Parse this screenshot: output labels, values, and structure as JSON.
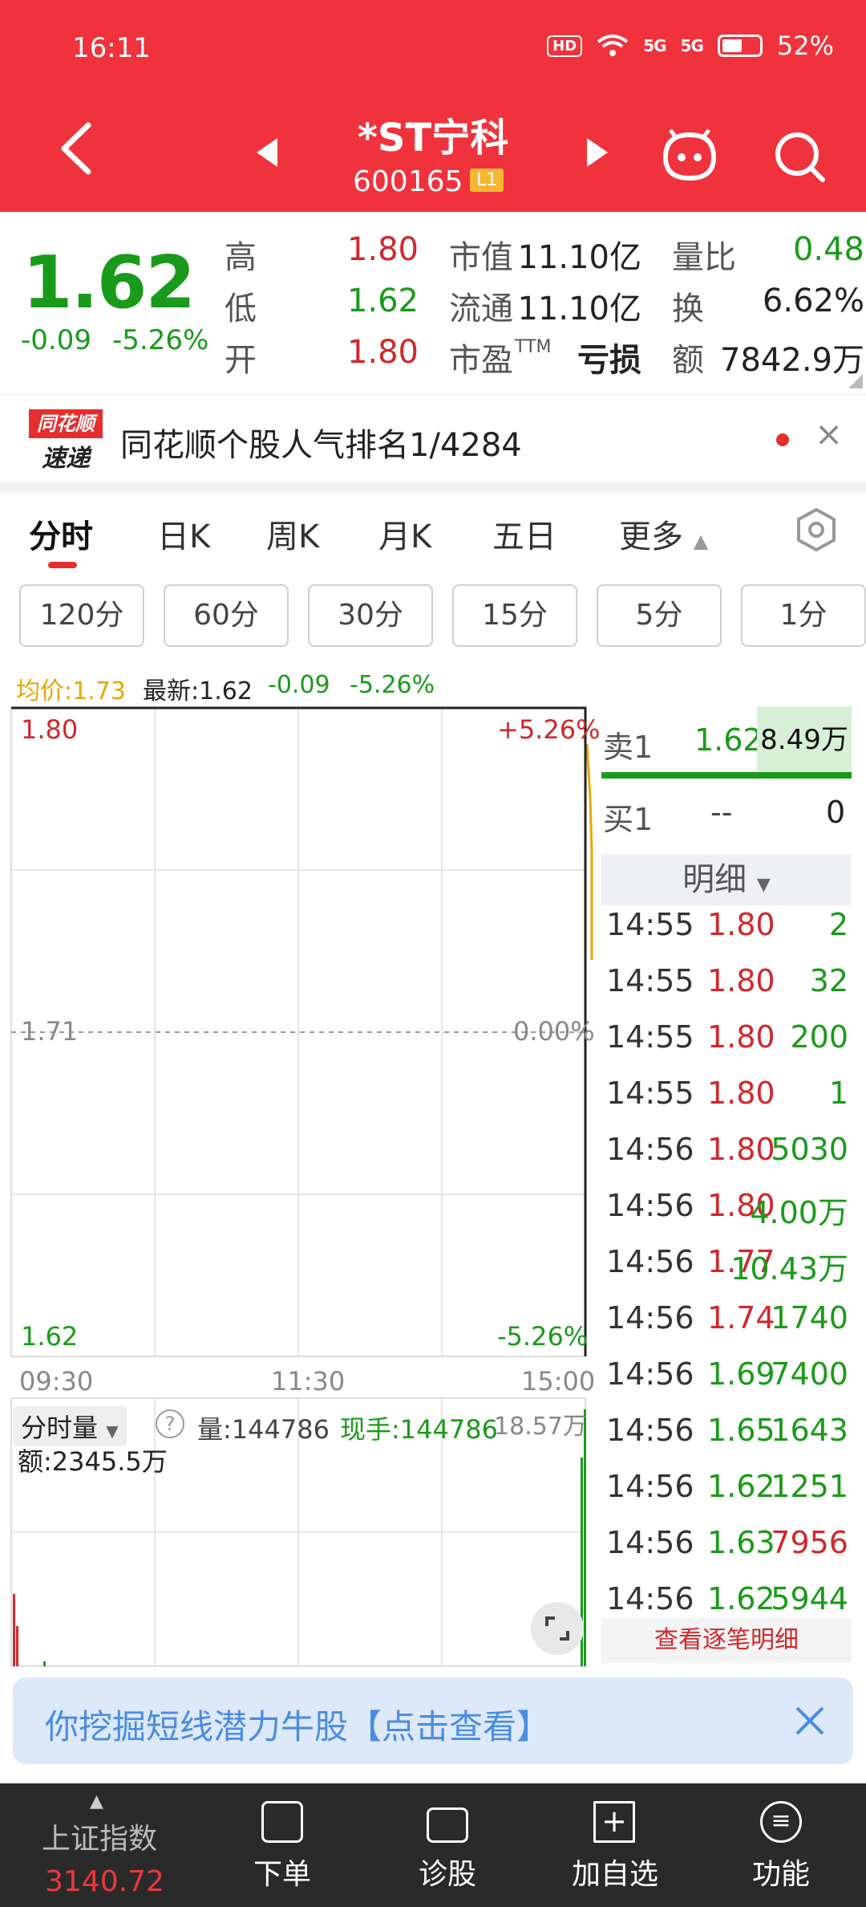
{
  "status_bar": {
    "time": "16:11",
    "hd": "HD",
    "sig1": "5G",
    "sig2": "5G",
    "battery": "52%"
  },
  "header": {
    "name": "*ST宁科",
    "code": "600165",
    "level": "L1"
  },
  "quote": {
    "price": "1.62",
    "change": "-0.09",
    "change_pct": "-5.26%",
    "high_label": "高",
    "high": "1.80",
    "low_label": "低",
    "low": "1.62",
    "open_label": "开",
    "open": "1.80",
    "mcap_label": "市值",
    "mcap": "11.10亿",
    "float_label": "流通",
    "float": "11.10亿",
    "pe_label": "市盈",
    "pe_sup": "TTM",
    "pe": "亏损",
    "vr_label": "量比",
    "vr": "0.48",
    "turn_label": "换",
    "turn": "6.62%",
    "amt_label": "额",
    "amt": "7842.9万"
  },
  "news": {
    "logo_top": "同花顺",
    "logo_bottom": "速递",
    "text": "同花顺个股人气排名1/4284"
  },
  "tabs": [
    "分时",
    "日K",
    "周K",
    "月K",
    "五日",
    "更多"
  ],
  "periods": [
    "120分",
    "60分",
    "30分",
    "15分",
    "5分",
    "1分"
  ],
  "chart_info": {
    "avg": "均价:1.73",
    "latest": "最新:1.62",
    "chg": "-0.09",
    "pct": "-5.26%"
  },
  "chart_data": {
    "type": "line",
    "y_top_price": "1.80",
    "y_mid_price": "1.71",
    "y_bot_price": "1.62",
    "y_top_pct": "+5.26%",
    "y_mid_pct": "0.00%",
    "y_bot_pct": "-5.26%",
    "x_ticks": [
      "09:30",
      "11:30",
      "15:00"
    ],
    "ylim": [
      1.62,
      1.8
    ],
    "series": [
      {
        "name": "price",
        "values": [
          1.8,
          1.8,
          1.62
        ]
      },
      {
        "name": "avg",
        "values": [
          1.78,
          1.76,
          1.73
        ]
      }
    ]
  },
  "volume": {
    "label": "分时量",
    "help": "?",
    "vol": "量:144786",
    "now": "现手:144786",
    "max": "18.57万",
    "amount": "额:2345.5万"
  },
  "orderbook": {
    "sell1_label": "卖1",
    "sell1_price": "1.62",
    "sell1_vol": "8.49万",
    "buy1_label": "买1",
    "buy1_price": "--",
    "buy1_vol": "0",
    "detail_label": "明细",
    "trades": [
      {
        "t": "14:55",
        "p": "1.80",
        "v": "2",
        "pc": "red",
        "vc": "green"
      },
      {
        "t": "14:55",
        "p": "1.80",
        "v": "32",
        "pc": "red",
        "vc": "green"
      },
      {
        "t": "14:55",
        "p": "1.80",
        "v": "200",
        "pc": "red",
        "vc": "green"
      },
      {
        "t": "14:55",
        "p": "1.80",
        "v": "1",
        "pc": "red",
        "vc": "green"
      },
      {
        "t": "14:56",
        "p": "1.80",
        "v": "5030",
        "pc": "red",
        "vc": "green"
      },
      {
        "t": "14:56",
        "p": "1.80",
        "v": "4.00万",
        "pc": "red",
        "vc": "green"
      },
      {
        "t": "14:56",
        "p": "1.77",
        "v": "10.43万",
        "pc": "red",
        "vc": "green"
      },
      {
        "t": "14:56",
        "p": "1.74",
        "v": "1740",
        "pc": "red",
        "vc": "green"
      },
      {
        "t": "14:56",
        "p": "1.69",
        "v": "7400",
        "pc": "green",
        "vc": "green"
      },
      {
        "t": "14:56",
        "p": "1.65",
        "v": "1643",
        "pc": "green",
        "vc": "green"
      },
      {
        "t": "14:56",
        "p": "1.62",
        "v": "1251",
        "pc": "green",
        "vc": "green"
      },
      {
        "t": "14:56",
        "p": "1.63",
        "v": "7956",
        "pc": "green",
        "vc": "red"
      },
      {
        "t": "14:56",
        "p": "1.62",
        "v": "5944",
        "pc": "green",
        "vc": "green"
      }
    ],
    "view_all": "查看逐笔明细"
  },
  "promo": {
    "text": "你挖掘短线潜力牛股【点击查看】"
  },
  "nav": {
    "index_name": "上证指数",
    "index_value": "3140.72",
    "order": "下单",
    "diagnose": "诊股",
    "add": "加自选",
    "func": "功能"
  },
  "colors": {
    "brand_red": "#f0323c",
    "up_red": "#d0282c",
    "down_green": "#1a9a1a",
    "avg_yellow": "#e6a700"
  }
}
